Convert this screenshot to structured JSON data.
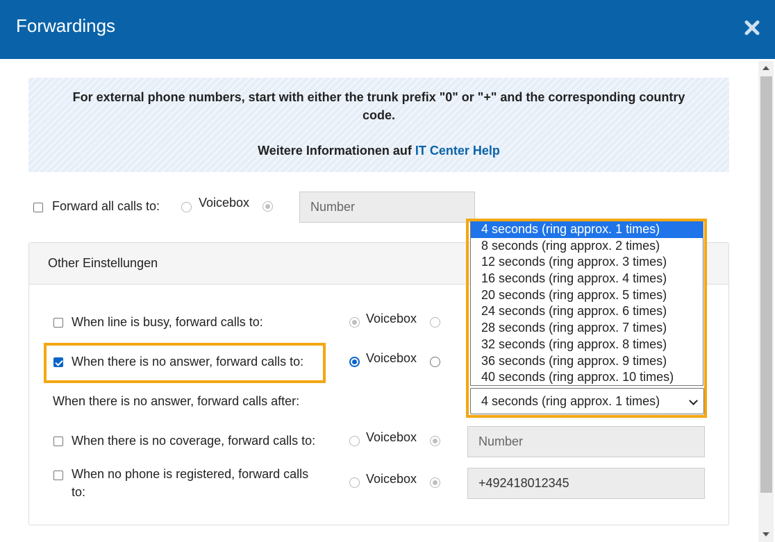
{
  "dialog": {
    "title": "Forwardings",
    "close_icon": "close-icon"
  },
  "info": {
    "line1": "For external phone numbers, start with either the trunk prefix \"0\" or \"+\" and the corresponding country code.",
    "line2_prefix": "Weitere Informationen auf",
    "link": "IT Center Help"
  },
  "forward_all": {
    "label": "Forward all calls to:",
    "checked": false,
    "voicebox_label": "Voicebox",
    "number_placeholder": "Number",
    "number_value": ""
  },
  "panel": {
    "title": "Other Einstellungen",
    "busy": {
      "label": "When line is busy, forward calls to:",
      "checked": false,
      "voicebox_label": "Voicebox"
    },
    "no_answer": {
      "label": "When there is no answer, forward calls to:",
      "checked": true,
      "voicebox_label": "Voicebox"
    },
    "no_answer_after": {
      "label": "When there is no answer, forward calls after:",
      "selected": "4 seconds (ring approx. 1 times)",
      "options": [
        "4 seconds (ring approx. 1 times)",
        "8 seconds (ring approx. 2 times)",
        "12 seconds (ring approx. 3 times)",
        "16 seconds (ring approx. 4 times)",
        "20 seconds (ring approx. 5 times)",
        "24 seconds (ring approx. 6 times)",
        "28 seconds (ring approx. 7 times)",
        "32 seconds (ring approx. 8 times)",
        "36 seconds (ring approx. 9 times)",
        "40 seconds (ring approx. 10 times)"
      ]
    },
    "no_coverage": {
      "label": "When there is no coverage, forward calls to:",
      "checked": false,
      "voicebox_label": "Voicebox",
      "number_placeholder": "Number",
      "number_value": ""
    },
    "no_phone": {
      "label_line1": "When no phone is registered, forward calls",
      "label_line2": "to:",
      "checked": false,
      "voicebox_label": "Voicebox",
      "number_value": "+492418012345"
    }
  },
  "colors": {
    "header": "#0a63a8",
    "highlight": "#f3a712",
    "link": "#0a63a8",
    "selected_option": "#1e74e8"
  }
}
